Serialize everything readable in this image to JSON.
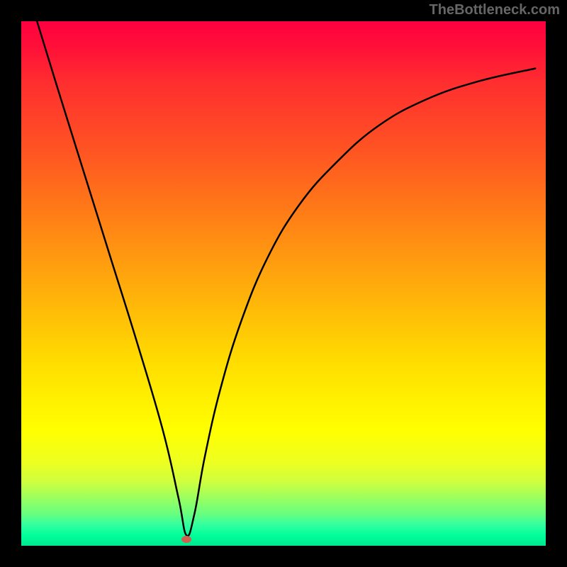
{
  "watermark": "TheBottleneck.com",
  "chart_data": {
    "type": "line",
    "title": "",
    "xlabel": "",
    "ylabel": "",
    "xlim": [
      0,
      100
    ],
    "ylim": [
      0,
      100
    ],
    "gradient_stops": [
      {
        "pos": 0,
        "color": "#ff0040"
      },
      {
        "pos": 0.25,
        "color": "#ff5522"
      },
      {
        "pos": 0.55,
        "color": "#ffbb08"
      },
      {
        "pos": 0.78,
        "color": "#ffff00"
      },
      {
        "pos": 0.94,
        "color": "#66ff80"
      },
      {
        "pos": 1.0,
        "color": "#00e890"
      }
    ],
    "series": [
      {
        "name": "bottleneck-curve",
        "x": [
          3,
          7,
          12,
          17,
          22,
          27,
          30,
          31.5,
          33,
          35,
          38,
          42,
          47,
          53,
          60,
          68,
          77,
          87,
          98
        ],
        "y": [
          100,
          87,
          71,
          55,
          39,
          22,
          9,
          2,
          6,
          17,
          30,
          43,
          55,
          65,
          73,
          80,
          85,
          88.5,
          91
        ]
      }
    ],
    "marker": {
      "x": 31.5,
      "y": 1.2,
      "color": "#d06050"
    }
  }
}
